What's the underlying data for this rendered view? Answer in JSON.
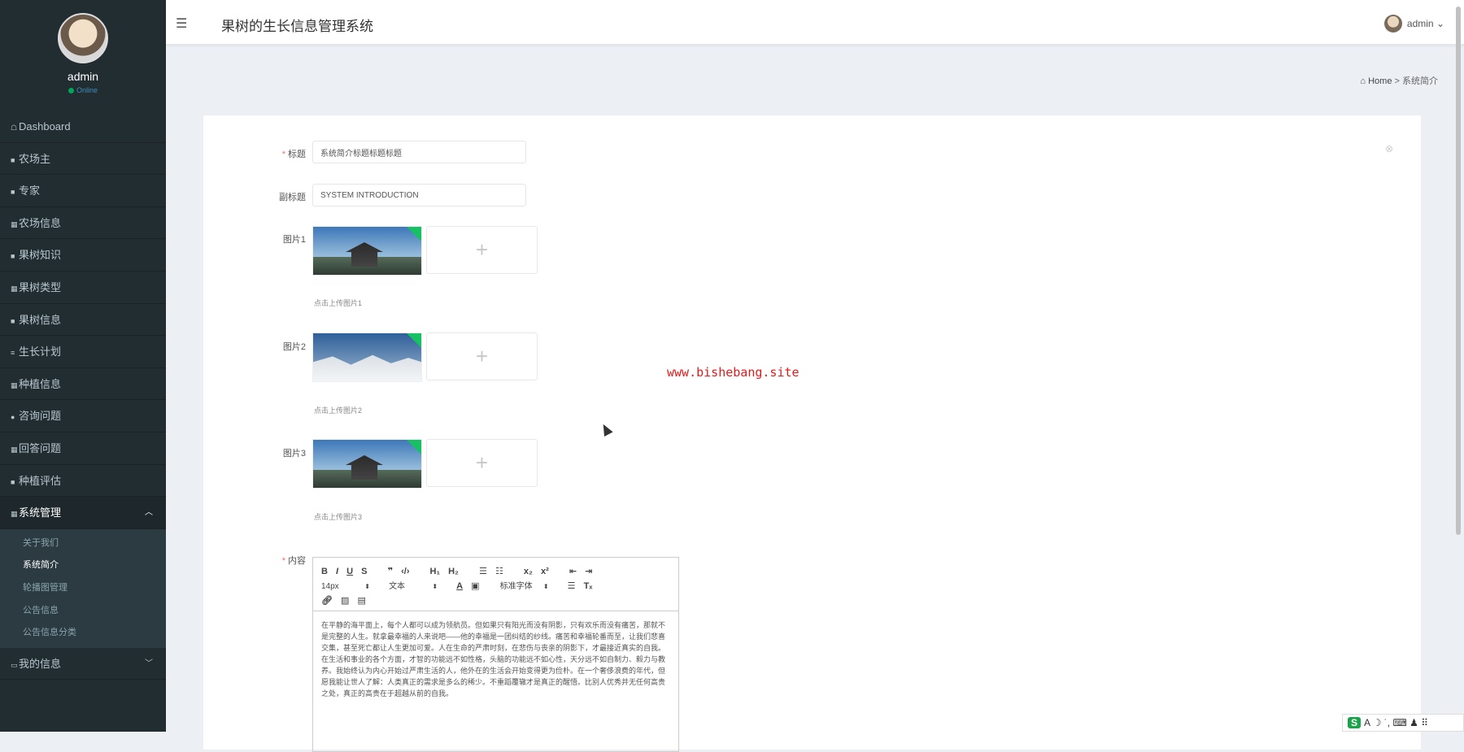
{
  "sidebar": {
    "user_name": "admin",
    "status": "Online",
    "menu": [
      {
        "icon": "☖",
        "label": "Dashboard"
      },
      {
        "icon": "■",
        "label": "农场主"
      },
      {
        "icon": "■",
        "label": "专家"
      },
      {
        "icon": "▦",
        "label": "农场信息"
      },
      {
        "icon": "■",
        "label": "果树知识"
      },
      {
        "icon": "▦",
        "label": "果树类型"
      },
      {
        "icon": "■",
        "label": "果树信息"
      },
      {
        "icon": "≡",
        "label": "生长计划"
      },
      {
        "icon": "▦",
        "label": "种植信息"
      },
      {
        "icon": "●",
        "label": "咨询问题"
      },
      {
        "icon": "▦",
        "label": "回答问题"
      },
      {
        "icon": "■",
        "label": "种植评估"
      }
    ],
    "system_menu": {
      "label": "系统管理",
      "items": [
        "关于我们",
        "系统简介",
        "轮播图管理",
        "公告信息",
        "公告信息分类"
      ]
    },
    "my_info": "我的信息"
  },
  "header": {
    "title": "果树的生长信息管理系统",
    "user": "admin"
  },
  "breadcrumb": {
    "home": "Home",
    "sep": ">",
    "current": "系统简介"
  },
  "form": {
    "title_label": "标题",
    "title_value": "系统简介标题标题标题",
    "subtitle_label": "副标题",
    "subtitle_value": "SYSTEM INTRODUCTION",
    "images": [
      {
        "label": "图片1",
        "hint": "点击上传图片1"
      },
      {
        "label": "图片2",
        "hint": "点击上传图片2"
      },
      {
        "label": "图片3",
        "hint": "点击上传图片3"
      }
    ],
    "content_label": "内容"
  },
  "editor": {
    "font_size": "14px",
    "text_type": "文本",
    "font_family": "标准字体",
    "content": "在平静的海平面上，每个人都可以成为领航员。但如果只有阳光而没有阴影，只有欢乐而没有痛苦，那就不是完整的人生。就拿最幸福的人来说吧——他的幸福是一团纠结的纱线。痛苦和幸福轮番而至，让我们悲喜交集，甚至死亡都让人生更加可爱。人在生命的严肃时刻，在悲伤与丧亲的阴影下，才最接近真实的自我。在生活和事业的各个方面，才智的功能远不如性格，头脑的功能远不如心性，天分远不如自制力、毅力与教养。我始终认为内心开始过严肃生活的人，他外在的生活会开始变得更为俭朴。在一个奢侈浪费的年代，但愿我能让世人了解：人类真正的需求是多么的稀少。不重蹈覆辙才是真正的醒悟。比别人优秀并无任何高贵之处，真正的高贵在于超越从前的自我。"
  },
  "watermark": "www.bishebang.site",
  "ime": {
    "brand": "S",
    "icons": "A ☽ ˙, ⌨ ♟ ⠿"
  }
}
